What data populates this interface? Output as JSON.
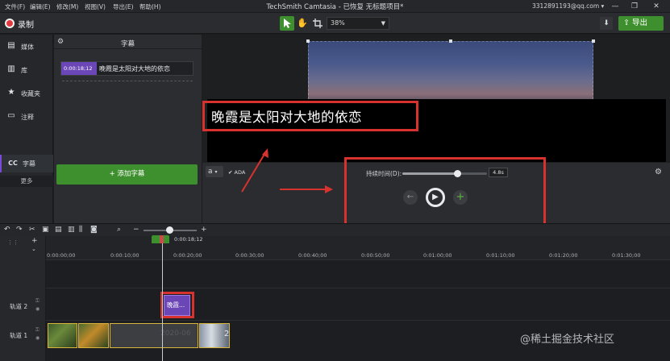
{
  "menu": [
    "文件(F)",
    "编辑(E)",
    "修改(M)",
    "视图(V)",
    "导出(E)",
    "帮助(H)"
  ],
  "window": {
    "title": "TechSmith Camtasia - 已恢复  无标题项目*",
    "account": "3312891193@qq.com ▾",
    "minimize": "—",
    "restore": "❐",
    "close": "✕"
  },
  "toolbar": {
    "record_label": "录制",
    "zoom_value": "38%",
    "export_label": "导出"
  },
  "leftnav": {
    "items": [
      {
        "icon": "film-icon",
        "label": "媒体"
      },
      {
        "icon": "library-icon",
        "label": "库"
      },
      {
        "icon": "star-icon",
        "label": "收藏夹"
      },
      {
        "icon": "annotation-icon",
        "label": "注释"
      },
      {
        "icon": "cc-icon",
        "label": "字幕"
      }
    ],
    "more": "更多"
  },
  "captions": {
    "panel_title": "字幕",
    "entry_time": "0:00:18;12",
    "entry_text": "晚霞是太阳对大地的依恋",
    "add_button": "+ 添加字幕"
  },
  "preview": {
    "caption_text": "晚霞是太阳对大地的依恋",
    "font_button": "a",
    "ada_label": "✔ ADA",
    "duration_label": "持续时间(D):",
    "duration_value": "4.8s",
    "duration_fraction": 0.65
  },
  "timeline": {
    "playhead_time": "0:00:18;12",
    "ticks": [
      "0:00:00;00",
      "0:00:10;00",
      "0:00:20;00",
      "0:00:30;00",
      "0:00:40;00",
      "0:00:50;00",
      "0:01:00;00",
      "0:01:10;00",
      "0:01:20;00",
      "0:01:30;00"
    ],
    "track2_label": "轨道 2",
    "track1_label": "轨道 1",
    "track2_clip": "晚霞...",
    "clip_date": "2020-06",
    "clip_number": "2"
  },
  "colors": {
    "accent_green": "#3e8f2d",
    "caption_purple": "#6b46b6",
    "highlight_red": "#d8322e"
  },
  "watermark": "@稀土掘金技术社区"
}
